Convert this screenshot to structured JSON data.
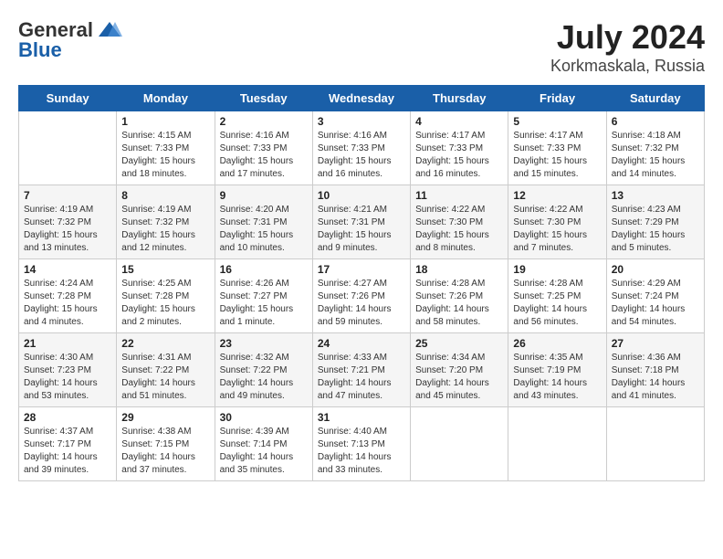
{
  "header": {
    "logo_general": "General",
    "logo_blue": "Blue",
    "title": "July 2024",
    "subtitle": "Korkmaskala, Russia"
  },
  "weekdays": [
    "Sunday",
    "Monday",
    "Tuesday",
    "Wednesday",
    "Thursday",
    "Friday",
    "Saturday"
  ],
  "weeks": [
    [
      {
        "day": "",
        "info": ""
      },
      {
        "day": "1",
        "info": "Sunrise: 4:15 AM\nSunset: 7:33 PM\nDaylight: 15 hours\nand 18 minutes."
      },
      {
        "day": "2",
        "info": "Sunrise: 4:16 AM\nSunset: 7:33 PM\nDaylight: 15 hours\nand 17 minutes."
      },
      {
        "day": "3",
        "info": "Sunrise: 4:16 AM\nSunset: 7:33 PM\nDaylight: 15 hours\nand 16 minutes."
      },
      {
        "day": "4",
        "info": "Sunrise: 4:17 AM\nSunset: 7:33 PM\nDaylight: 15 hours\nand 16 minutes."
      },
      {
        "day": "5",
        "info": "Sunrise: 4:17 AM\nSunset: 7:33 PM\nDaylight: 15 hours\nand 15 minutes."
      },
      {
        "day": "6",
        "info": "Sunrise: 4:18 AM\nSunset: 7:32 PM\nDaylight: 15 hours\nand 14 minutes."
      }
    ],
    [
      {
        "day": "7",
        "info": "Sunrise: 4:19 AM\nSunset: 7:32 PM\nDaylight: 15 hours\nand 13 minutes."
      },
      {
        "day": "8",
        "info": "Sunrise: 4:19 AM\nSunset: 7:32 PM\nDaylight: 15 hours\nand 12 minutes."
      },
      {
        "day": "9",
        "info": "Sunrise: 4:20 AM\nSunset: 7:31 PM\nDaylight: 15 hours\nand 10 minutes."
      },
      {
        "day": "10",
        "info": "Sunrise: 4:21 AM\nSunset: 7:31 PM\nDaylight: 15 hours\nand 9 minutes."
      },
      {
        "day": "11",
        "info": "Sunrise: 4:22 AM\nSunset: 7:30 PM\nDaylight: 15 hours\nand 8 minutes."
      },
      {
        "day": "12",
        "info": "Sunrise: 4:22 AM\nSunset: 7:30 PM\nDaylight: 15 hours\nand 7 minutes."
      },
      {
        "day": "13",
        "info": "Sunrise: 4:23 AM\nSunset: 7:29 PM\nDaylight: 15 hours\nand 5 minutes."
      }
    ],
    [
      {
        "day": "14",
        "info": "Sunrise: 4:24 AM\nSunset: 7:28 PM\nDaylight: 15 hours\nand 4 minutes."
      },
      {
        "day": "15",
        "info": "Sunrise: 4:25 AM\nSunset: 7:28 PM\nDaylight: 15 hours\nand 2 minutes."
      },
      {
        "day": "16",
        "info": "Sunrise: 4:26 AM\nSunset: 7:27 PM\nDaylight: 15 hours\nand 1 minute."
      },
      {
        "day": "17",
        "info": "Sunrise: 4:27 AM\nSunset: 7:26 PM\nDaylight: 14 hours\nand 59 minutes."
      },
      {
        "day": "18",
        "info": "Sunrise: 4:28 AM\nSunset: 7:26 PM\nDaylight: 14 hours\nand 58 minutes."
      },
      {
        "day": "19",
        "info": "Sunrise: 4:28 AM\nSunset: 7:25 PM\nDaylight: 14 hours\nand 56 minutes."
      },
      {
        "day": "20",
        "info": "Sunrise: 4:29 AM\nSunset: 7:24 PM\nDaylight: 14 hours\nand 54 minutes."
      }
    ],
    [
      {
        "day": "21",
        "info": "Sunrise: 4:30 AM\nSunset: 7:23 PM\nDaylight: 14 hours\nand 53 minutes."
      },
      {
        "day": "22",
        "info": "Sunrise: 4:31 AM\nSunset: 7:22 PM\nDaylight: 14 hours\nand 51 minutes."
      },
      {
        "day": "23",
        "info": "Sunrise: 4:32 AM\nSunset: 7:22 PM\nDaylight: 14 hours\nand 49 minutes."
      },
      {
        "day": "24",
        "info": "Sunrise: 4:33 AM\nSunset: 7:21 PM\nDaylight: 14 hours\nand 47 minutes."
      },
      {
        "day": "25",
        "info": "Sunrise: 4:34 AM\nSunset: 7:20 PM\nDaylight: 14 hours\nand 45 minutes."
      },
      {
        "day": "26",
        "info": "Sunrise: 4:35 AM\nSunset: 7:19 PM\nDaylight: 14 hours\nand 43 minutes."
      },
      {
        "day": "27",
        "info": "Sunrise: 4:36 AM\nSunset: 7:18 PM\nDaylight: 14 hours\nand 41 minutes."
      }
    ],
    [
      {
        "day": "28",
        "info": "Sunrise: 4:37 AM\nSunset: 7:17 PM\nDaylight: 14 hours\nand 39 minutes."
      },
      {
        "day": "29",
        "info": "Sunrise: 4:38 AM\nSunset: 7:15 PM\nDaylight: 14 hours\nand 37 minutes."
      },
      {
        "day": "30",
        "info": "Sunrise: 4:39 AM\nSunset: 7:14 PM\nDaylight: 14 hours\nand 35 minutes."
      },
      {
        "day": "31",
        "info": "Sunrise: 4:40 AM\nSunset: 7:13 PM\nDaylight: 14 hours\nand 33 minutes."
      },
      {
        "day": "",
        "info": ""
      },
      {
        "day": "",
        "info": ""
      },
      {
        "day": "",
        "info": ""
      }
    ]
  ]
}
